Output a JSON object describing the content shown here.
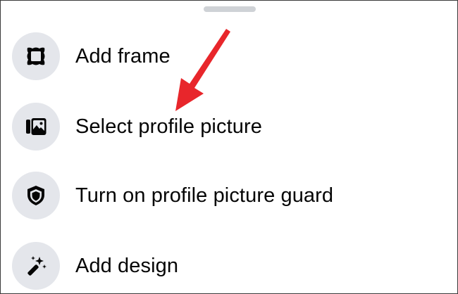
{
  "sheet": {
    "menu_items": [
      {
        "label": "Add frame",
        "icon": "frame-icon"
      },
      {
        "label": "Select profile picture",
        "icon": "photo-gallery-icon"
      },
      {
        "label": "Turn on profile picture guard",
        "icon": "shield-icon"
      },
      {
        "label": "Add design",
        "icon": "magic-wand-icon"
      }
    ]
  },
  "colors": {
    "icon_background": "#e4e6eb",
    "text": "#050505",
    "annotation_arrow": "#e8262b",
    "drag_handle": "#cfd2d6"
  }
}
